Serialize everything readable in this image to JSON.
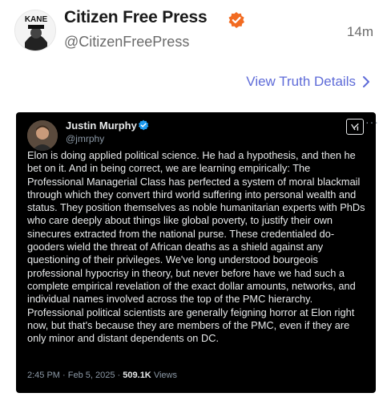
{
  "post": {
    "display_name": "Citizen Free Press",
    "handle": "@CitizenFreePress",
    "time_ago": "14m",
    "avatar_text": "KANE",
    "view_details_label": "View Truth Details"
  },
  "embedded_tweet": {
    "author_name": "Justin Murphy",
    "author_handle": "@jmrphy",
    "text": "Elon is doing applied political science. He had a hypothesis, and then he bet on it. And in being correct, we are learning empirically: The Professional Managerial Class has perfected a system of moral blackmail through which they convert third world suffering into personal wealth and status. They position themselves as noble humanitarian experts with PhDs who care deeply about things like global poverty, to justify their own sinecures extracted from the national purse. These credentialed do-gooders wield the threat of African deaths as a shield against any questioning of their privileges. We've long understood bourgeois professional hypocrisy in theory, but never before have we had such a complete empirical revelation of the exact dollar amounts, networks, and individual names involved across the top of the PMC hierarchy. Professional political scientists are generally feigning horror at Elon right now, but that's because they are members of the PMC, even if they are only minor and distant dependents on DC.",
    "time": "2:45 PM",
    "separator": "·",
    "date": "Feb 5, 2025",
    "views_count": "509.1K",
    "views_label": "Views"
  },
  "colors": {
    "link": "#5e6bd8",
    "verified_orange": "#f26b21",
    "verified_blue": "#1d9bf0",
    "card_bg": "#000000"
  },
  "icons": {
    "verified": "verified-badge-icon",
    "chevron": "chevron-right-icon",
    "grok": "grok-icon",
    "more": "more-icon"
  }
}
